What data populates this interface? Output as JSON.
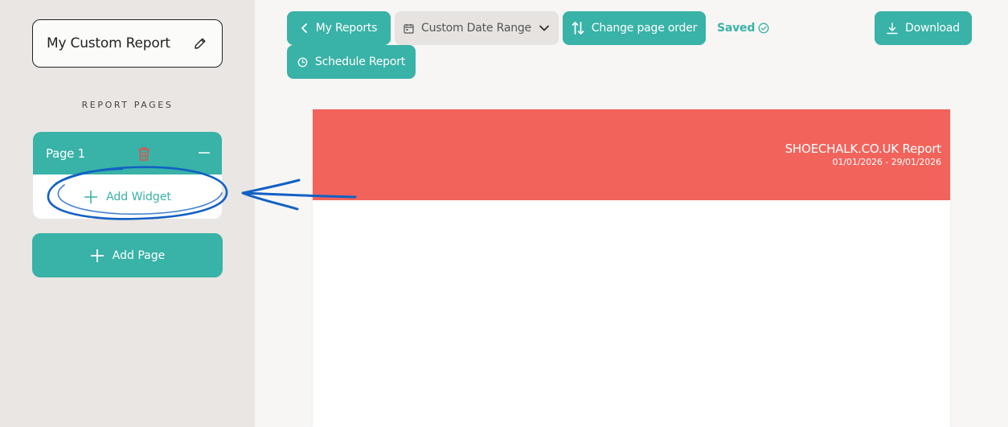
{
  "sidebar": {
    "report_name": "My Custom Report",
    "section_label": "REPORT PAGES",
    "pages": [
      {
        "label": "Page 1",
        "add_widget_label": "Add Widget"
      }
    ],
    "add_page_label": "Add Page"
  },
  "toolbar": {
    "my_reports_label": "My Reports",
    "date_range_label": "Custom Date Range",
    "change_order_label": "Change page order",
    "saved_label": "Saved",
    "download_label": "Download",
    "schedule_label": "Schedule Report"
  },
  "report": {
    "title": "SHOECHALK.CO.UK Report",
    "date_range": "01/01/2026 - 29/01/2026"
  },
  "colors": {
    "accent": "#39b2a7",
    "banner": "#f2635b",
    "annotation": "#1261c4",
    "delete": "#e0524a"
  }
}
